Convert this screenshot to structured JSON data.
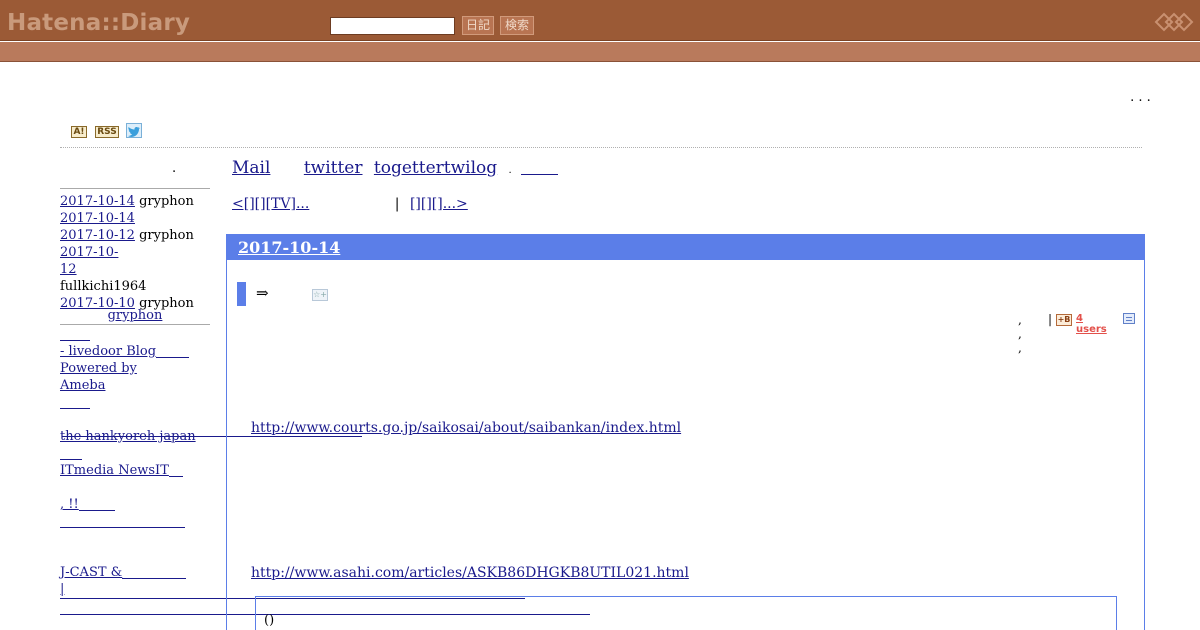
{
  "header": {
    "logo": "Hatena::Diary",
    "search_value": "",
    "diary_button": "日記",
    "search_button": "検索"
  },
  "top_right": {
    "ellipsis": ". . ."
  },
  "icons": {
    "antenna": "A!",
    "rss": "RSS"
  },
  "sidebar": {
    "dot": ".",
    "recent_comments": [
      {
        "date": "2017-10-14",
        "user": "gryphon"
      },
      {
        "date": "2017-10-14",
        "user": ""
      },
      {
        "date": "2017-10-12",
        "user": "gryphon"
      },
      {
        "date": "2017-10-12",
        "user": "fullkichi1964"
      },
      {
        "date": "2017-10-10",
        "user": "gryphon"
      }
    ],
    "gryphon_link": "gryphon",
    "links": {
      "livedoor": " - livedoor Blog",
      "powered_by": "Powered by",
      "ameba": "Ameba",
      "hankyoreh": "the hankyoreh japan",
      "itmedia": "ITmedia NewsIT",
      "exclaim": ", !!",
      "jcast": "J-CAST &",
      "pipe": " |"
    }
  },
  "main": {
    "nav": {
      "mail": "Mail",
      "twitter": "twitter",
      "togetter": "togettertwilog",
      "dot": "."
    },
    "pager": {
      "prev": "<[][][TV]...",
      "sep": "|",
      "next": "[][][]...>"
    },
    "day": {
      "date": "2017-10-14",
      "arrow": "⇒",
      "star_add": "☆+",
      "meta_commas": ", , ,",
      "meta_bar": "|",
      "hatebu_icon": "+B",
      "users": "4 users",
      "url1": "http://www.courts.go.jp/saikosai/about/saibankan/index.html",
      "url2": "http://www.asahi.com/articles/ASKB86DHGKB8UTIL021.html",
      "quote": "()"
    }
  },
  "colors": {
    "header_bg": "#9b5a36",
    "subbar_bg": "#b97a5c",
    "accent_blue": "#5b7ee8",
    "link": "#1a1a8c",
    "users_red": "#e3504a"
  }
}
